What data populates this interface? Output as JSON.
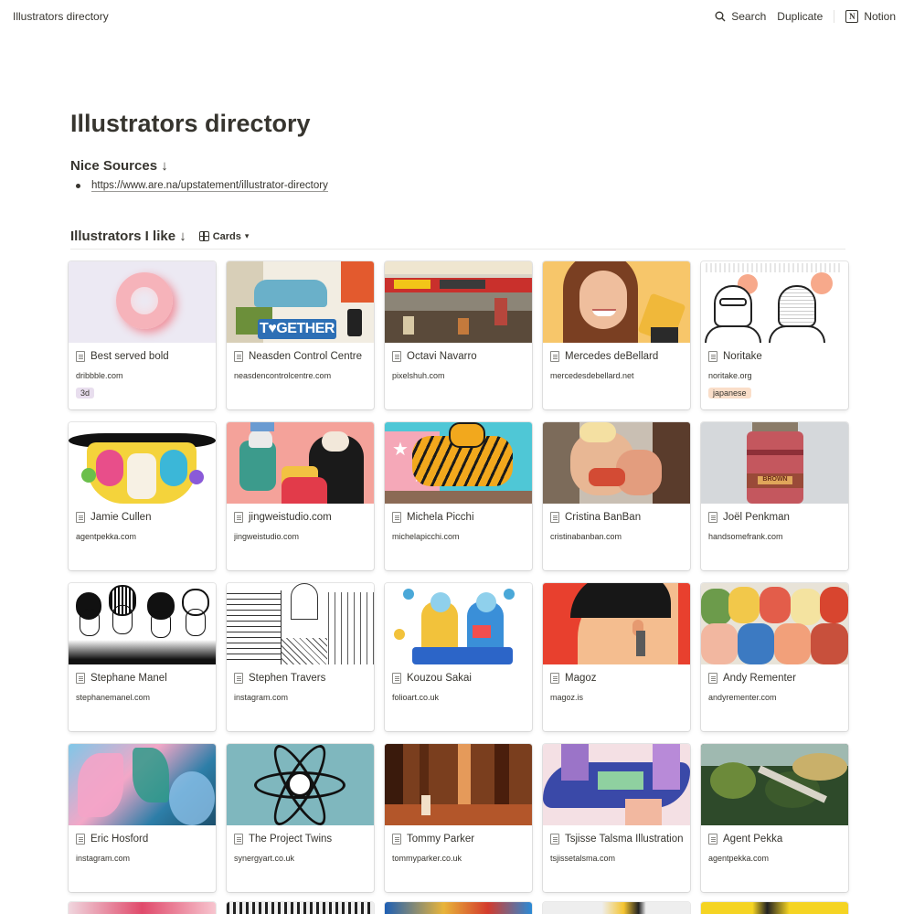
{
  "topbar": {
    "breadcrumb": "Illustrators directory",
    "search_label": "Search",
    "duplicate_label": "Duplicate",
    "notion_label": "Notion"
  },
  "page": {
    "title": "Illustrators directory",
    "sources_heading": "Nice Sources ↓",
    "sources": [
      "https://www.are.na/upstatement/illustrator-directory"
    ],
    "database_title": "Illustrators I like ↓",
    "view_label": "Cards"
  },
  "cards": [
    {
      "title": "Best served bold",
      "url": "dribbble.com",
      "tag": "3d",
      "tag_color": "#e8deee",
      "cover": "3d-swirl"
    },
    {
      "title": "Neasden Control Centre",
      "url": "neasdencontrolcentre.com",
      "tag": "",
      "cover": "together-collage"
    },
    {
      "title": "Octavi Navarro",
      "url": "pixelshuh.com",
      "tag": "",
      "cover": "pixel-race"
    },
    {
      "title": "Mercedes deBellard",
      "url": "mercedesdebellard.net",
      "tag": "",
      "cover": "portrait-woman"
    },
    {
      "title": "Noritake",
      "url": "noritake.org",
      "tag": "japanese",
      "tag_color": "#fadec9",
      "cover": "line-heads"
    },
    {
      "title": "Jamie Cullen",
      "url": "agentpekka.com",
      "tag": "",
      "cover": "colorful-faces"
    },
    {
      "title": "jingweistudio.com",
      "url": "jingweistudio.com",
      "tag": "",
      "cover": "pink-scene"
    },
    {
      "title": "Michela Picchi",
      "url": "michelapicchi.com",
      "tag": "",
      "cover": "tiger-stars"
    },
    {
      "title": "Cristina BanBan",
      "url": "cristinabanban.com",
      "tag": "",
      "cover": "painted-figures"
    },
    {
      "title": "Joël Penkman",
      "url": "handsomefrank.com",
      "tag": "",
      "cover": "jar-paint"
    },
    {
      "title": "Stephane Manel",
      "url": "stephanemanel.com",
      "tag": "",
      "cover": "ink-band"
    },
    {
      "title": "Stephen Travers",
      "url": "instagram.com",
      "tag": "",
      "cover": "paris-sketch"
    },
    {
      "title": "Kouzou Sakai",
      "url": "folioart.co.uk",
      "tag": "",
      "cover": "blue-laptop"
    },
    {
      "title": "Magoz",
      "url": "magoz.is",
      "tag": "",
      "cover": "red-head"
    },
    {
      "title": "Andy Rementer",
      "url": "andyrementer.com",
      "tag": "",
      "cover": "crowd"
    },
    {
      "title": "Eric Hosford",
      "url": "instagram.com",
      "tag": "",
      "cover": "pastel-leaves"
    },
    {
      "title": "The Project Twins",
      "url": "synergyart.co.uk",
      "tag": "",
      "cover": "atom-globe"
    },
    {
      "title": "Tommy Parker",
      "url": "tommyparker.co.uk",
      "tag": "",
      "cover": "forest-brown"
    },
    {
      "title": "Tsjisse Talsma Illustration",
      "url": "tsjissetalsma.com",
      "tag": "",
      "cover": "blue-hand"
    },
    {
      "title": "Agent Pekka",
      "url": "agentpekka.com",
      "tag": "",
      "cover": "green-forest"
    }
  ],
  "colors": {
    "text": "#37352f",
    "tag_purple": "#e8deee",
    "tag_orange": "#fadec9"
  }
}
